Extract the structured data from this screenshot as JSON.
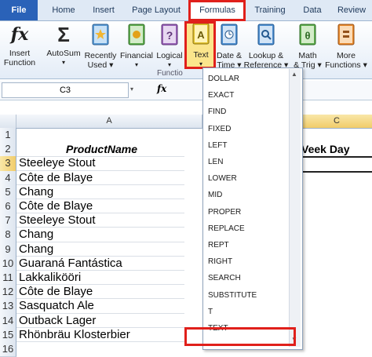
{
  "tabs": [
    "File",
    "Home",
    "Insert",
    "Page Layout",
    "Formulas",
    "Training",
    "Data",
    "Review"
  ],
  "ribbon": {
    "buttons": [
      {
        "label1": "Insert",
        "label2": "Function",
        "icon": "fx-icon"
      },
      {
        "label1": "AutoSum",
        "label2": "",
        "icon": "sigma-icon"
      },
      {
        "label1": "Recently",
        "label2": "Used",
        "icon": "book-star-icon"
      },
      {
        "label1": "Financial",
        "label2": "",
        "icon": "book-icon"
      },
      {
        "label1": "Logical",
        "label2": "",
        "icon": "book-question-icon"
      },
      {
        "label1": "Text",
        "label2": "",
        "icon": "book-a-icon"
      },
      {
        "label1": "Date &",
        "label2": "Time",
        "icon": "book-clock-icon"
      },
      {
        "label1": "Lookup &",
        "label2": "Reference",
        "icon": "book-search-icon"
      },
      {
        "label1": "Math",
        "label2": "& Trig",
        "icon": "book-theta-icon"
      },
      {
        "label1": "More",
        "label2": "Functions",
        "icon": "book-more-icon"
      }
    ],
    "group_label": "Functio"
  },
  "formula_bar": {
    "name_box": "C3",
    "fx": "fx"
  },
  "columns": {
    "a": "A",
    "c": "C"
  },
  "header_row": {
    "product": "ProductName",
    "c_partial": "Veek Day"
  },
  "rows": [
    "1",
    "2",
    "3",
    "4",
    "5",
    "6",
    "7",
    "8",
    "9",
    "10",
    "11",
    "12",
    "13",
    "14",
    "15",
    "16"
  ],
  "products": [
    "Steeleye Stout",
    "Côte de Blaye",
    "Chang",
    "Côte de Blaye",
    "Steeleye Stout",
    "Chang",
    "Chang",
    "Guaraná Fantástica",
    "Lakkalikööri",
    "Côte de Blaye",
    "Sasquatch Ale",
    "Outback Lager",
    "Rhönbräu Klosterbier"
  ],
  "dropdown_items": [
    "DOLLAR",
    "EXACT",
    "FIND",
    "FIXED",
    "LEFT",
    "LEN",
    "LOWER",
    "MID",
    "PROPER",
    "REPLACE",
    "REPT",
    "RIGHT",
    "SEARCH",
    "SUBSTITUTE",
    "T",
    "TEXT"
  ],
  "colors": {
    "highlight": "#e0201b",
    "file_tab": "#2a62b8",
    "selected_button": "#fbe58c"
  }
}
